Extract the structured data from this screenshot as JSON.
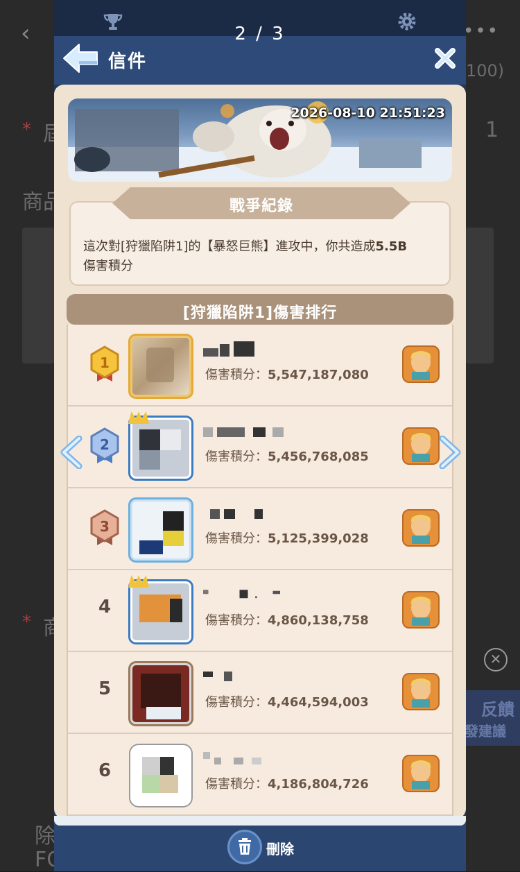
{
  "counter": "2 / 3",
  "header": {
    "title": "信件"
  },
  "banner": {
    "timestamp": "2026-08-10 21:51:23"
  },
  "war_record": {
    "title": "戰爭紀錄",
    "text_prefix": "這次對[狩獵陷阱1]的【暴怒巨熊】進攻中，你共造成",
    "text_value": "5.5B",
    "text_suffix": "傷害積分"
  },
  "ranking": {
    "title": "[狩獵陷阱1]傷害排行",
    "score_label": "傷害積分：",
    "rows": [
      {
        "rank": "1",
        "score": "5,547,187,080",
        "medal": "gold"
      },
      {
        "rank": "2",
        "score": "5,456,768,085",
        "medal": "blue"
      },
      {
        "rank": "3",
        "score": "5,125,399,028",
        "medal": "bronze"
      },
      {
        "rank": "4",
        "score": "4,860,138,758",
        "medal": "none"
      },
      {
        "rank": "5",
        "score": "4,464,594,003",
        "medal": "none"
      },
      {
        "rank": "6",
        "score": "4,186,804,726",
        "medal": "none"
      }
    ]
  },
  "footer": {
    "delete_label": "刪除"
  },
  "background_page": {
    "texts": [
      "商品",
      "除",
      "FO"
    ],
    "price_fragment": "100)",
    "quantity": "1",
    "feedback": [
      "反饋",
      "發建議"
    ]
  },
  "colors": {
    "modal_bg": "#233757",
    "card_bg": "#efe2d0",
    "score_text": "#6a5646",
    "header_bg": "#2d4a78"
  },
  "icons": [
    "trophy-icon",
    "gear-icon",
    "back-arrow-icon",
    "close-icon",
    "medal-icon",
    "hero-portrait-icon",
    "trash-icon",
    "chevron-left-icon",
    "chevron-right-icon"
  ]
}
